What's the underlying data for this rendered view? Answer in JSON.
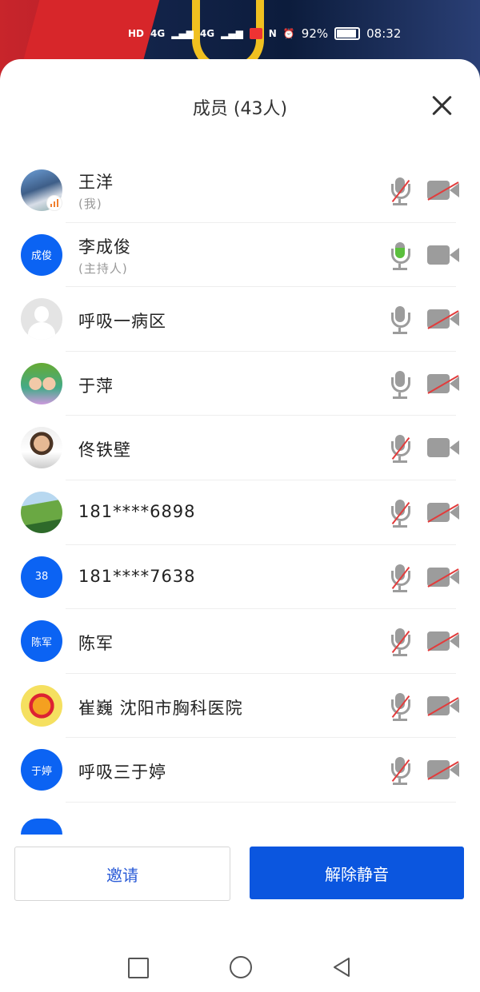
{
  "status_bar": {
    "network": "4G",
    "battery": "92%",
    "time": "08:32"
  },
  "header": {
    "title": "成员 (43人)"
  },
  "members": [
    {
      "name": "王洋",
      "role": "(我)",
      "mic": "muted",
      "camera": "off"
    },
    {
      "name": "李成俊",
      "role": "(主持人)",
      "avatar_text": "成俊",
      "mic": "on",
      "camera": "on"
    },
    {
      "name": "呼吸一病区",
      "role": "",
      "mic": "on",
      "camera": "off"
    },
    {
      "name": "于萍",
      "role": "",
      "mic": "on",
      "camera": "off"
    },
    {
      "name": "佟铁壁",
      "role": "",
      "mic": "muted",
      "camera": "on"
    },
    {
      "name": "181****6898",
      "role": "",
      "mic": "muted",
      "camera": "off"
    },
    {
      "name": "181****7638",
      "role": "",
      "avatar_text": "38",
      "mic": "muted",
      "camera": "off"
    },
    {
      "name": "陈军",
      "role": "",
      "avatar_text": "陈军",
      "mic": "muted",
      "camera": "off"
    },
    {
      "name": "崔巍  沈阳市胸科医院",
      "role": "",
      "mic": "muted",
      "camera": "off"
    },
    {
      "name": "呼吸三于婷",
      "role": "",
      "avatar_text": "于婷",
      "mic": "muted",
      "camera": "off"
    }
  ],
  "actions": {
    "invite": "邀请",
    "unmute_all": "解除静音"
  },
  "colors": {
    "primary": "#0b56df",
    "avatar_blue": "#0b63f3",
    "muted_red": "#e23c3c",
    "mic_green": "#5bbf3d"
  }
}
